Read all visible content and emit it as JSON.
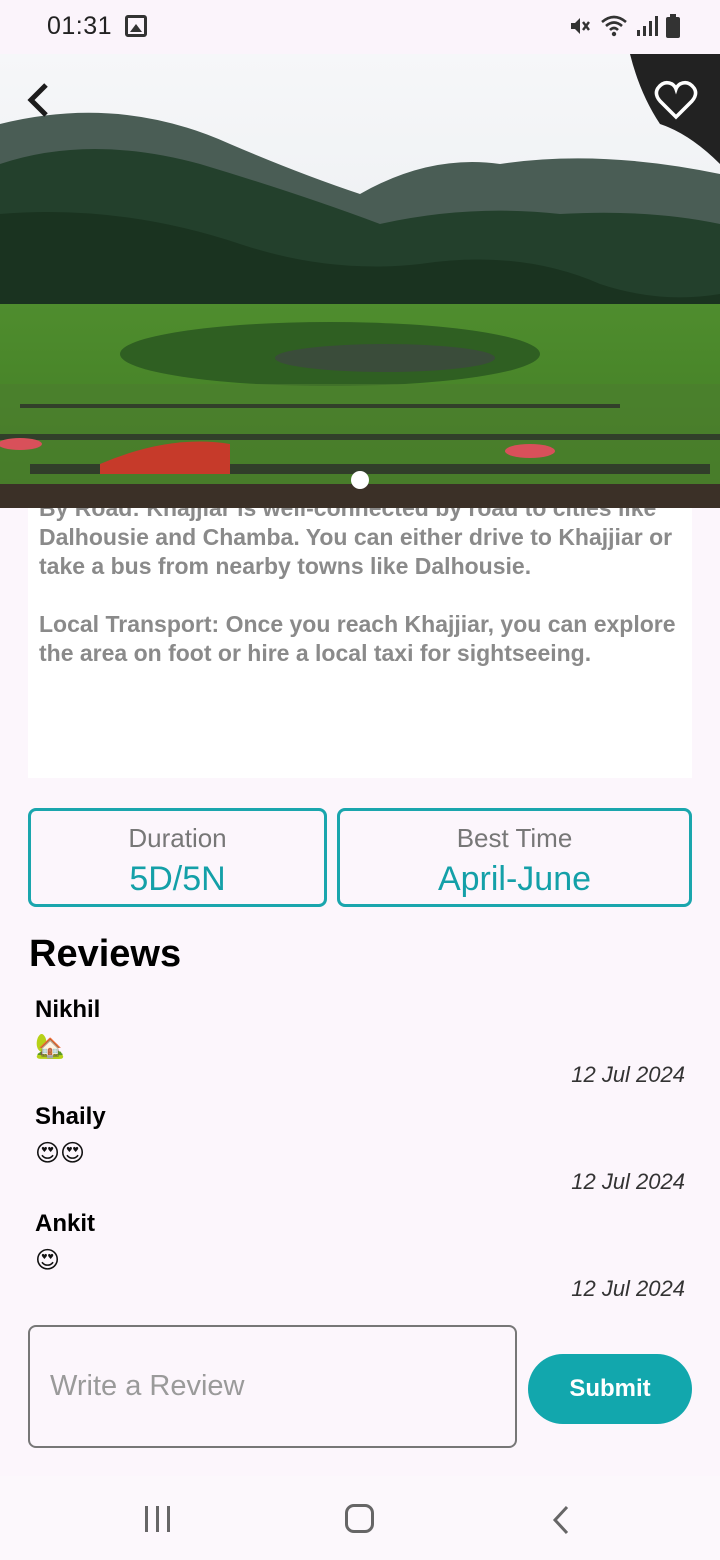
{
  "status_bar": {
    "time": "01:31",
    "icons": [
      "image-icon",
      "mute-icon",
      "wifi-icon",
      "signal-icon",
      "battery-icon"
    ]
  },
  "hero": {
    "back_icon": "chevron-left-icon",
    "favorite_icon": "heart-outline-icon",
    "pager": {
      "current": 1,
      "total": 1
    }
  },
  "description": {
    "paragraphs": [
      "By Road: Khajjiar is well-connected by road to cities like Dalhousie and Chamba. You can either drive to Khajjiar or take a bus from nearby towns like Dalhousie.",
      "Local Transport: Once you reach Khajjiar, you can explore the area on foot or hire a local taxi for sightseeing."
    ]
  },
  "info": {
    "duration_label": "Duration",
    "duration_value": "5D/5N",
    "best_time_label": "Best Time",
    "best_time_value": "April-June"
  },
  "reviews": {
    "title": "Reviews",
    "items": [
      {
        "name": "Nikhil",
        "text": "🏡",
        "date": "12 Jul 2024"
      },
      {
        "name": "Shaily",
        "text": "😍😍",
        "date": "12 Jul 2024"
      },
      {
        "name": "Ankit",
        "text": "😍",
        "date": "12 Jul 2024"
      }
    ]
  },
  "review_form": {
    "placeholder": "Write a Review",
    "value": "",
    "submit_label": "Submit"
  },
  "colors": {
    "accent": "#12a7ad",
    "background": "#fcf6fc"
  },
  "nav_bar": {
    "icons": [
      "recents-icon",
      "home-icon",
      "back-icon"
    ]
  }
}
